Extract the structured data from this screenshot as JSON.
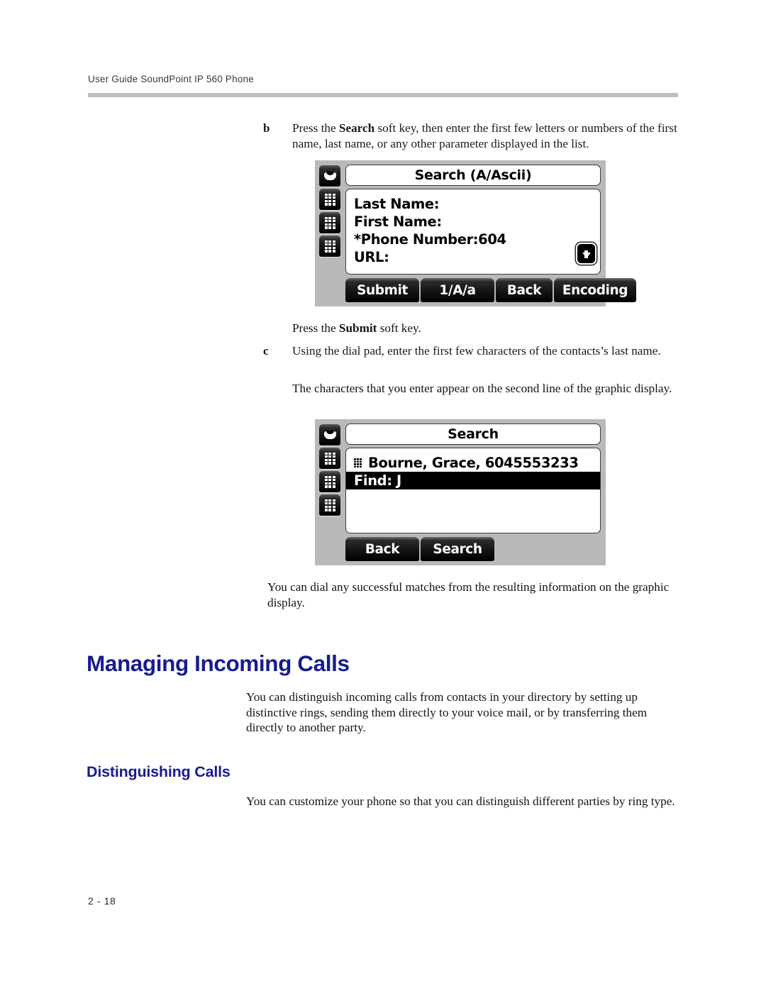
{
  "header": {
    "running_head": "User Guide SoundPoint IP 560 Phone"
  },
  "footer": {
    "page_number": "2 - 18"
  },
  "colors": {
    "heading_blue": "#171c8f",
    "rule_gray": "#bfbfbf",
    "phone_body_gray": "#b9b9b9"
  },
  "steps": {
    "b": {
      "marker": "b",
      "text_part1": "Press the ",
      "bold1": "Search",
      "text_part2": " soft key, then enter the first few letters or numbers of the first name, last name, or any other parameter displayed in the list."
    },
    "submit_note": {
      "text_part1": "Press the ",
      "bold1": "Submit",
      "text_part2": " soft key."
    },
    "c": {
      "marker": "c",
      "text": "Using the dial pad, enter the first few characters of the contacts’s last name."
    },
    "c_note": {
      "text": "The characters that you enter appear on the second line of the graphic display."
    },
    "dial_note": {
      "text": "You can dial any successful matches from the resulting information on the graphic display."
    }
  },
  "figure_search_form": {
    "line_keys": [
      {
        "icon": "handset-icon"
      },
      {
        "icon": "keypad-icon"
      },
      {
        "icon": "keypad-icon"
      },
      {
        "icon": "keypad-icon"
      }
    ],
    "title": "Search (A/Ascii)",
    "lines": [
      "Last Name:",
      "First Name:",
      "*Phone Number:604",
      "URL:"
    ],
    "scroll_indicator": "arrow-down-icon",
    "softkeys": [
      "Submit",
      "1/A/a",
      "Back",
      "Encoding"
    ]
  },
  "figure_search_results": {
    "line_keys": [
      {
        "icon": "handset-icon"
      },
      {
        "icon": "keypad-icon"
      },
      {
        "icon": "keypad-icon"
      },
      {
        "icon": "keypad-icon"
      }
    ],
    "title": "Search",
    "result_entry": "Bourne, Grace, 6045553233",
    "result_entry_icon": "keypad-icon",
    "find_line": "Find: J",
    "softkeys": [
      "Back",
      "Search"
    ]
  },
  "sections": {
    "managing_incoming_calls": {
      "heading": "Managing Incoming Calls",
      "body": "You can distinguish incoming calls from contacts in your directory by setting up distinctive rings, sending them directly to your voice mail, or by transferring them directly to another party."
    },
    "distinguishing_calls": {
      "heading": "Distinguishing Calls",
      "body": "You can customize your phone so that you can distinguish different parties by ring type."
    }
  }
}
